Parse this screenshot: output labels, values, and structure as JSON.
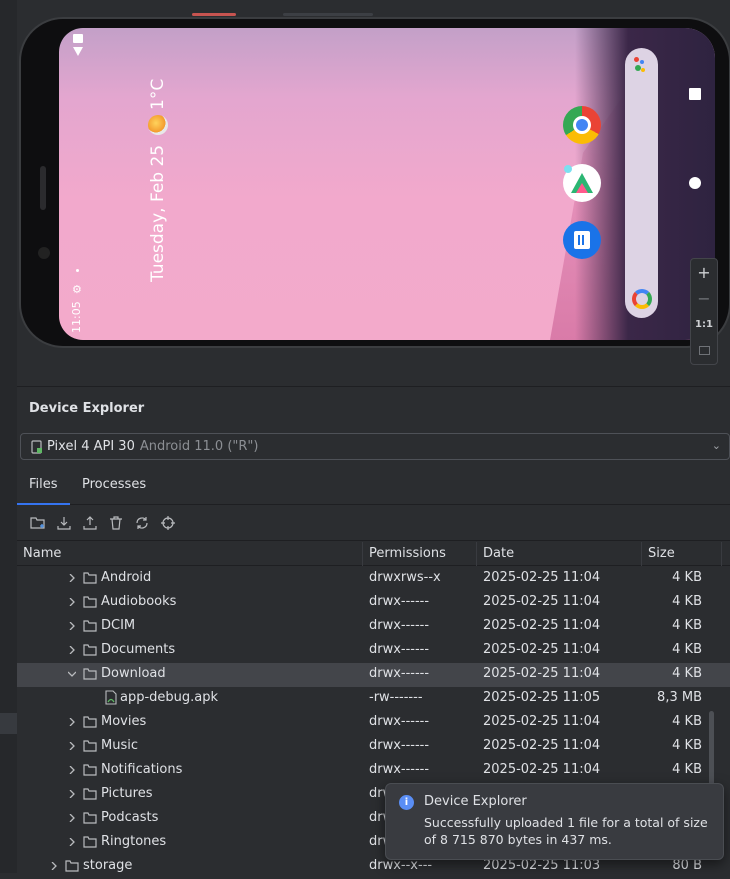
{
  "emulator": {
    "date_text": "Tuesday, Feb 25",
    "weather_text": "1°C",
    "clock": "11:05",
    "zoom": {
      "plus": "+",
      "minus": "−",
      "one_to_one": "1:1"
    }
  },
  "panel": {
    "title": "Device Explorer",
    "device": {
      "name": "Pixel 4 API 30",
      "sub": "Android 11.0 (\"R\")"
    },
    "tabs": [
      "Files",
      "Processes"
    ],
    "columns": {
      "name": "Name",
      "permissions": "Permissions",
      "date": "Date",
      "size": "Size"
    },
    "rows": [
      {
        "name": "Android",
        "perm": "drwxrws--x",
        "date": "2025-02-25 11:04",
        "size": "4 KB",
        "kind": "folder",
        "state": "collapsed",
        "level": 2
      },
      {
        "name": "Audiobooks",
        "perm": "drwx------",
        "date": "2025-02-25 11:04",
        "size": "4 KB",
        "kind": "folder",
        "state": "collapsed",
        "level": 2
      },
      {
        "name": "DCIM",
        "perm": "drwx------",
        "date": "2025-02-25 11:04",
        "size": "4 KB",
        "kind": "folder",
        "state": "collapsed",
        "level": 2
      },
      {
        "name": "Documents",
        "perm": "drwx------",
        "date": "2025-02-25 11:04",
        "size": "4 KB",
        "kind": "folder",
        "state": "collapsed",
        "level": 2
      },
      {
        "name": "Download",
        "perm": "drwx------",
        "date": "2025-02-25 11:04",
        "size": "4 KB",
        "kind": "folder",
        "state": "expanded",
        "level": 2,
        "selected": true
      },
      {
        "name": "app-debug.apk",
        "perm": "-rw-------",
        "date": "2025-02-25 11:05",
        "size": "8,3 MB",
        "kind": "apk",
        "level": 3
      },
      {
        "name": "Movies",
        "perm": "drwx------",
        "date": "2025-02-25 11:04",
        "size": "4 KB",
        "kind": "folder",
        "state": "collapsed",
        "level": 2
      },
      {
        "name": "Music",
        "perm": "drwx------",
        "date": "2025-02-25 11:04",
        "size": "4 KB",
        "kind": "folder",
        "state": "collapsed",
        "level": 2
      },
      {
        "name": "Notifications",
        "perm": "drwx------",
        "date": "2025-02-25 11:04",
        "size": "4 KB",
        "kind": "folder",
        "state": "collapsed",
        "level": 2
      },
      {
        "name": "Pictures",
        "perm": "drw",
        "date": "",
        "size": "",
        "kind": "folder",
        "state": "collapsed",
        "level": 2
      },
      {
        "name": "Podcasts",
        "perm": "drw",
        "date": "",
        "size": "",
        "kind": "folder",
        "state": "collapsed",
        "level": 2
      },
      {
        "name": "Ringtones",
        "perm": "drw",
        "date": "",
        "size": "",
        "kind": "folder",
        "state": "collapsed",
        "level": 2
      },
      {
        "name": "storage",
        "perm": "drwx--x---",
        "date": "2025-02-25 11:03",
        "size": "80 B",
        "kind": "folder",
        "state": "collapsed",
        "level": 1
      }
    ],
    "toast": {
      "title": "Device Explorer",
      "message": "Successfully uploaded 1 file for a total of size of 8 715 870 bytes in 437 ms."
    }
  },
  "colors": {
    "accent": "#3574f0",
    "background": "#2b2d30",
    "selected_row": "#43454a"
  }
}
